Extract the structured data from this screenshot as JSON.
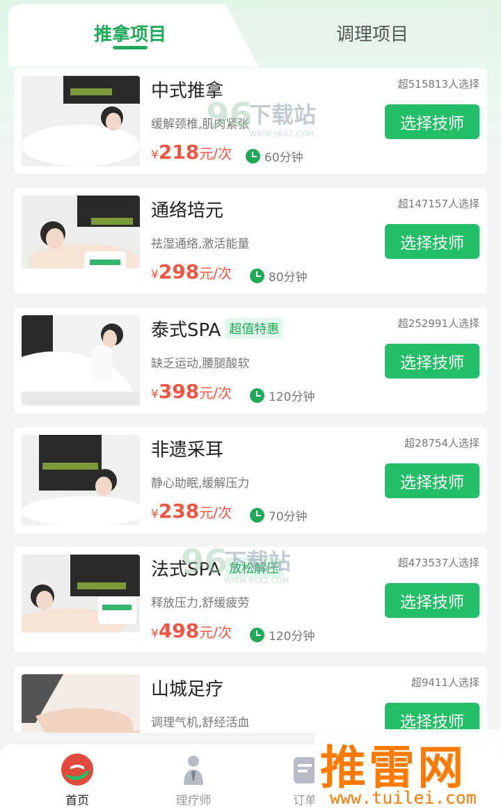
{
  "tabs": [
    {
      "label": "推拿项目"
    },
    {
      "label": "调理项目"
    }
  ],
  "services": [
    {
      "name": "中式推拿",
      "tag": "",
      "desc": "缓解颈椎,肌肉紧张",
      "yen": "¥",
      "price": "218",
      "unit": "元/次",
      "duration": "60分钟",
      "sold": "超515813人选择",
      "button": "选择技师"
    },
    {
      "name": "通络培元",
      "tag": "",
      "desc": "祛湿通络,激活能量",
      "yen": "¥",
      "price": "298",
      "unit": "元/次",
      "duration": "80分钟",
      "sold": "超147157人选择",
      "button": "选择技师"
    },
    {
      "name": "泰式SPA",
      "tag": "超值特惠",
      "desc": "缺乏运动,腰腿酸软",
      "yen": "¥",
      "price": "398",
      "unit": "元/次",
      "duration": "120分钟",
      "sold": "超252991人选择",
      "button": "选择技师"
    },
    {
      "name": "非遗采耳",
      "tag": "",
      "desc": "静心助眠,缓解压力",
      "yen": "¥",
      "price": "238",
      "unit": "元/次",
      "duration": "70分钟",
      "sold": "超28754人选择",
      "button": "选择技师"
    },
    {
      "name": "法式SPA",
      "tag": "放松解压",
      "desc": "释放压力,舒缓疲劳",
      "yen": "¥",
      "price": "498",
      "unit": "元/次",
      "duration": "120分钟",
      "sold": "超473537人选择",
      "button": "选择技师"
    },
    {
      "name": "山城足疗",
      "tag": "",
      "desc": "调理气机,舒经活血",
      "yen": "¥",
      "price": "",
      "unit": "",
      "duration": "",
      "sold": "超9411人选择",
      "button": "选择技师"
    }
  ],
  "nav": [
    {
      "label": "首页",
      "active": true
    },
    {
      "label": "理疗师",
      "active": false
    },
    {
      "label": "订单",
      "active": false
    }
  ],
  "watermark": {
    "text": "下载站",
    "url": "WWW.96XZ.COM"
  },
  "brand": {
    "text": "推雷网",
    "url": "www.tuilei.com"
  },
  "colors": {
    "accent": "#22bf67",
    "price": "#f2553f",
    "brand": "#ff7a00"
  }
}
